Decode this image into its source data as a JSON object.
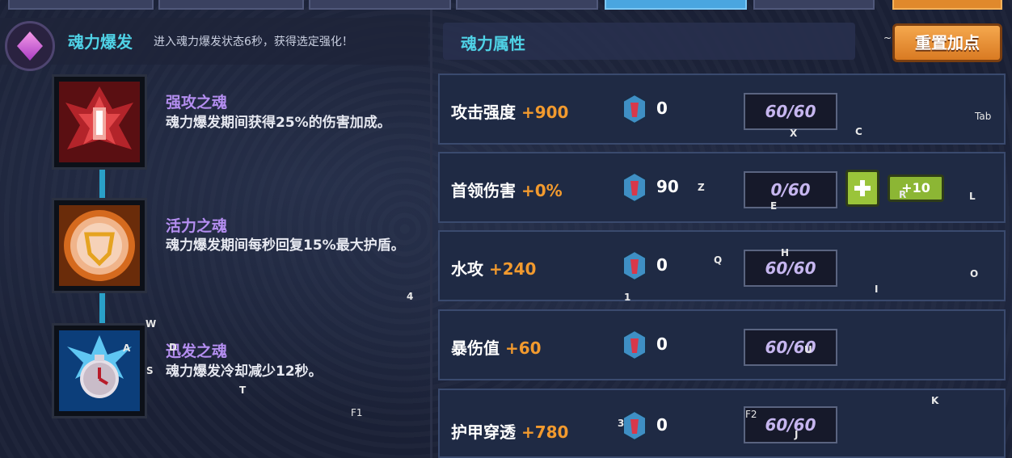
{
  "burst": {
    "title": "魂力爆发",
    "description": "进入魂力爆发状态6秒，获得选定强化！"
  },
  "souls": [
    {
      "name": "强攻之魂",
      "description": "魂力爆发期间获得25%的伤害加成。",
      "icon": "red-flame-soul-icon"
    },
    {
      "name": "活力之魂",
      "description": "魂力爆发期间每秒回复15%最大护盾。",
      "icon": "orange-shield-soul-icon"
    },
    {
      "name": "迅发之魂",
      "description": "魂力爆发冷却减少12秒。",
      "icon": "blue-clock-soul-icon"
    }
  ],
  "attributes": {
    "title": "魂力属性",
    "reset_label": "重置加点",
    "rows": [
      {
        "label": "攻击强度",
        "bonus": "+900",
        "gems": "0",
        "cap": "60/60"
      },
      {
        "label": "首领伤害",
        "bonus": "+0%",
        "gems": "90",
        "cap": "0/60",
        "plus_label": "+",
        "plus10_label": "+10"
      },
      {
        "label": "水攻",
        "bonus": "+240",
        "gems": "0",
        "cap": "60/60"
      },
      {
        "label": "暴伤值",
        "bonus": "+60",
        "gems": "0",
        "cap": "60/60"
      },
      {
        "label": "护甲穿透",
        "bonus": "+780",
        "gems": "0",
        "cap": "60/60"
      }
    ]
  },
  "key_hints": [
    "~",
    "Tab",
    "X",
    "C",
    "Z",
    "E",
    "R",
    "L",
    "H",
    "Q",
    "I",
    "O",
    "1",
    "4",
    "W",
    "A",
    "S",
    "D",
    "T",
    "F1",
    "U",
    "K",
    "F2",
    "J",
    "3"
  ],
  "colors": {
    "accent_cyan": "#4fd2e6",
    "bonus_orange": "#f29a2e",
    "soul_name_purple": "#b48ef0",
    "reset_orange": "#e0892c",
    "plus_green": "#9ac43a"
  }
}
